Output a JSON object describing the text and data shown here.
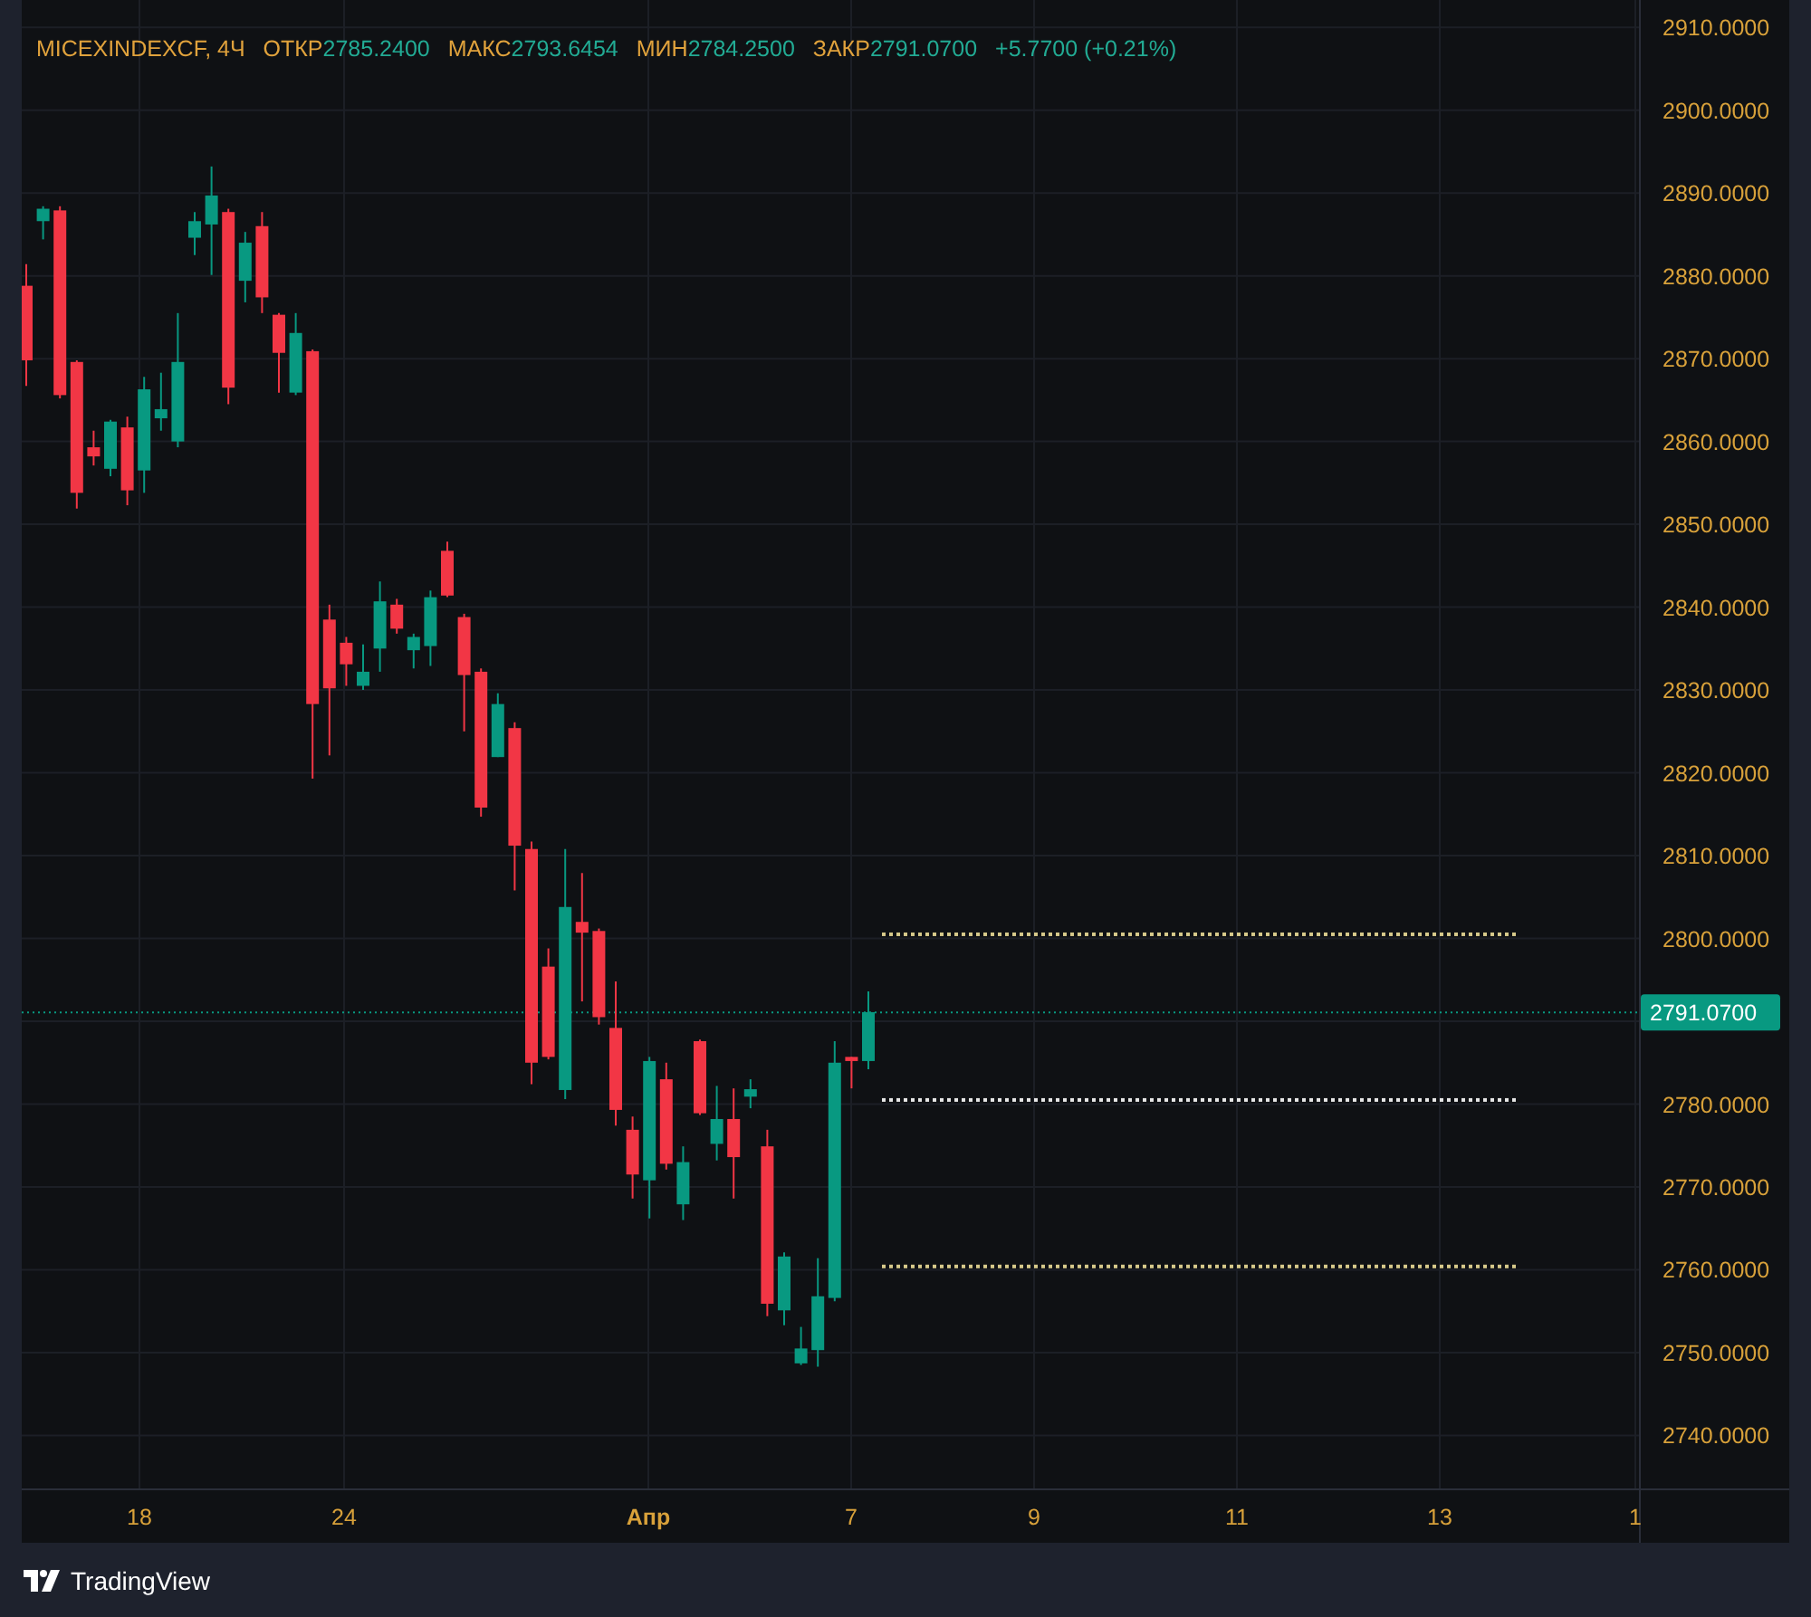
{
  "legend": {
    "symbol": "MICEXINDEXCF, 4Ч",
    "fields": [
      {
        "label": "ОТКР",
        "value": "2785.2400"
      },
      {
        "label": "МАКС",
        "value": "2793.6454"
      },
      {
        "label": "МИН",
        "value": "2784.2500"
      },
      {
        "label": "ЗАКР",
        "value": "2791.0700"
      }
    ],
    "change": "+5.7700 (+0.21%)"
  },
  "price_axis": {
    "labels": [
      "2910.0000",
      "2900.0000",
      "2890.0000",
      "2880.0000",
      "2870.0000",
      "2860.0000",
      "2850.0000",
      "2840.0000",
      "2830.0000",
      "2820.0000",
      "2810.0000",
      "2800.0000",
      "2780.0000",
      "2770.0000",
      "2760.0000",
      "2750.0000",
      "2740.0000"
    ],
    "last_price": "2791.0700"
  },
  "time_axis": {
    "labels": [
      {
        "text": "18",
        "kind": "day"
      },
      {
        "text": "24",
        "kind": "day"
      },
      {
        "text": "Апр",
        "kind": "month"
      },
      {
        "text": "7",
        "kind": "day"
      },
      {
        "text": "9",
        "kind": "day"
      },
      {
        "text": "11",
        "kind": "day"
      },
      {
        "text": "13",
        "kind": "day"
      },
      {
        "text": "1",
        "kind": "day"
      }
    ]
  },
  "drawings": [
    {
      "kind": "level_line",
      "color": "#d6c98a"
    },
    {
      "kind": "level_line",
      "color": "#e6e6e6"
    },
    {
      "kind": "level_line",
      "color": "#d6c98a"
    }
  ],
  "footer": {
    "brand": "TradingView"
  }
}
